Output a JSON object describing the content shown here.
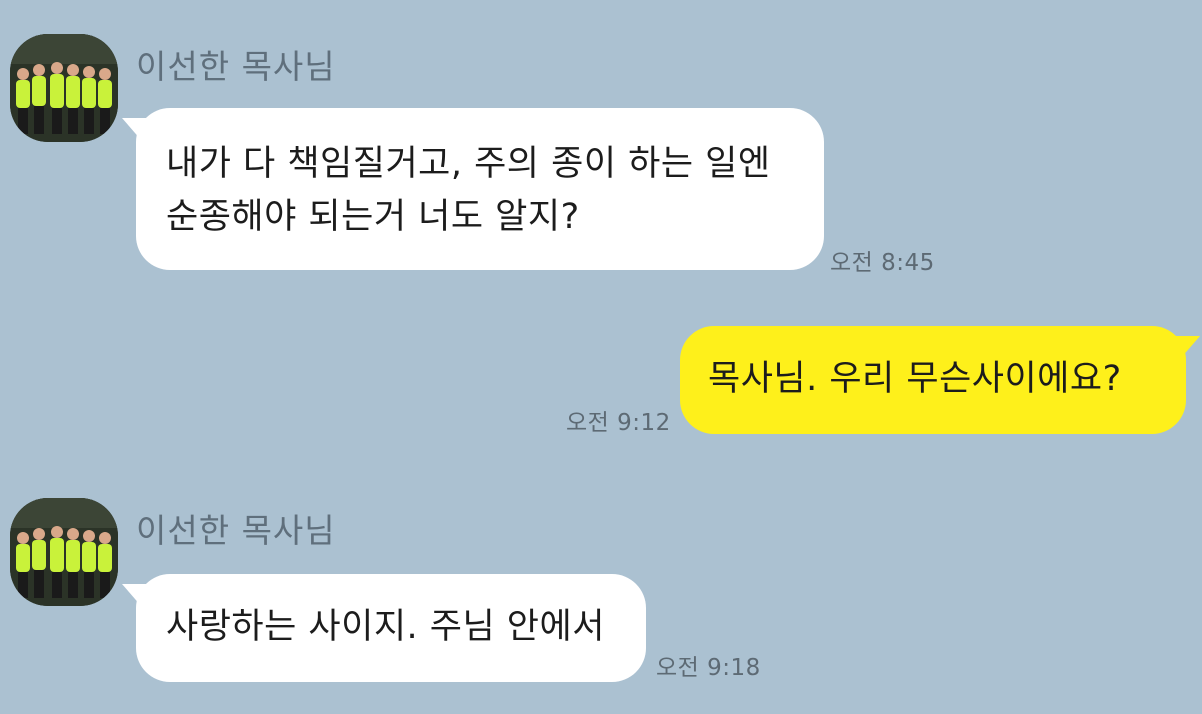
{
  "chat": {
    "messages": [
      {
        "direction": "incoming",
        "sender": "이선한 목사님",
        "lines": [
          "내가 다 책임질거고, 주의 종이 하는 일엔",
          "순종해야 되는거 너도 알지?"
        ],
        "time": "오전 8:45"
      },
      {
        "direction": "outgoing",
        "lines": [
          "목사님. 우리 무슨사이에요?"
        ],
        "time": "오전 9:12"
      },
      {
        "direction": "incoming",
        "sender": "이선한 목사님",
        "lines": [
          "사랑하는 사이지. 주님 안에서"
        ],
        "time": "오전 9:18"
      }
    ]
  },
  "colors": {
    "background": "#abc1d1",
    "incoming_bubble": "#ffffff",
    "outgoing_bubble": "#fef01b"
  },
  "icons": {
    "avatar": "group-photo-avatar"
  }
}
